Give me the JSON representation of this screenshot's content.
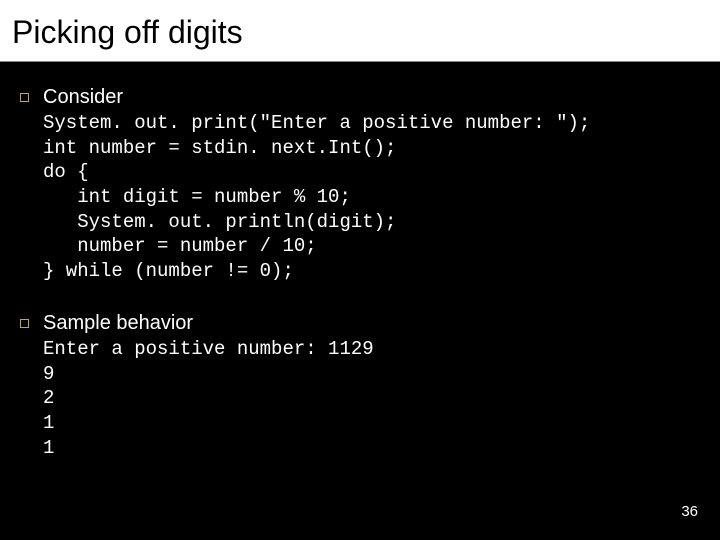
{
  "title": "Picking off digits",
  "block1": {
    "intro": "Consider",
    "code": "System. out. print(\"Enter a positive number: \");\nint number = stdin. next.Int();\ndo {\n   int digit = number % 10;\n   System. out. println(digit);\n   number = number / 10;\n} while (number != 0);"
  },
  "block2": {
    "intro": "Sample behavior",
    "output": "Enter a positive number: 1129\n9\n2\n1\n1"
  },
  "page_number": "36"
}
